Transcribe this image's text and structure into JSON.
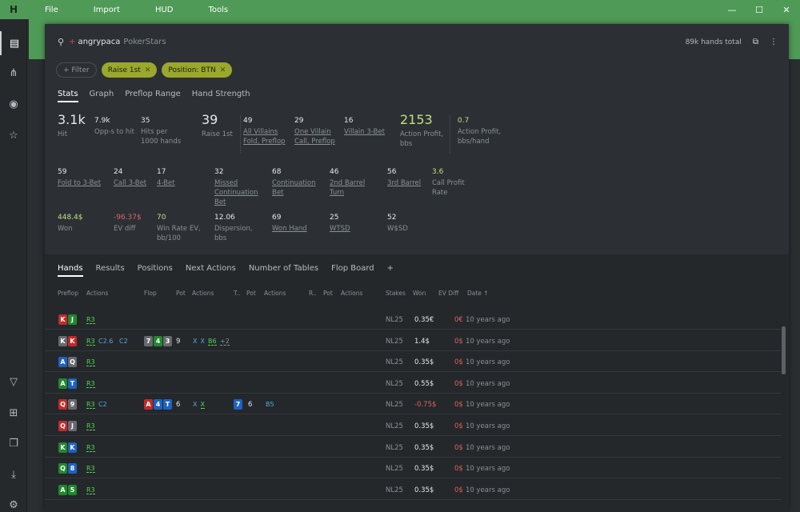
{
  "titlebar": {
    "logo": "H",
    "menu": [
      "File",
      "Import",
      "HUD",
      "Tools"
    ],
    "controls": [
      "—",
      "☐",
      "✕"
    ]
  },
  "sidebar": {
    "top_icons": [
      "report-icon",
      "share-icon",
      "broadcast-icon",
      "star-list-icon"
    ],
    "bottom_icons": [
      "filter-icon",
      "layout-icon",
      "windows-icon",
      "download-icon",
      "settings-icon"
    ]
  },
  "header": {
    "plus": "+",
    "username": "angrypaca",
    "site": "PokerStars",
    "total": "89k hands total"
  },
  "filters": {
    "add_label": "Filter",
    "chips": [
      "Raise 1st",
      "Position: BTN"
    ]
  },
  "stat_tabs": [
    "Stats",
    "Graph",
    "Preflop Range",
    "Hand Strength"
  ],
  "stats_row1": [
    {
      "value": "3.1k",
      "label": "Hit",
      "big": true
    },
    {
      "value": "7.9k",
      "label": "Opp-s to hit"
    },
    {
      "value": "35",
      "label": "Hits per 1000 hands"
    },
    {
      "value": "39",
      "label": "Raise 1st",
      "big": true
    },
    {
      "value": "49",
      "label": "All Villains Fold, Preflop",
      "link": true
    },
    {
      "value": "29",
      "label": "One Villain Call, Preflop",
      "link": true
    },
    {
      "value": "16",
      "label": "Villain 3-Bet",
      "link": true
    },
    {
      "value": "2153",
      "label": "Action Profit, bbs",
      "big": true,
      "color": "green"
    },
    {
      "value": "0.7",
      "label": "Action Profit, bbs/hand",
      "color": "green"
    }
  ],
  "stats_row2": [
    {
      "value": "59",
      "label": "Fold to 3-Bet",
      "link": true
    },
    {
      "value": "24",
      "label": "Call 3-Bet",
      "link": true
    },
    {
      "value": "17",
      "label": "4-Bet",
      "link": true
    },
    {
      "value": "32",
      "label": "Missed Continuation Bet",
      "link": true
    },
    {
      "value": "68",
      "label": "Continuation Bet",
      "link": true
    },
    {
      "value": "46",
      "label": "2nd Barrel Turn",
      "link": true
    },
    {
      "value": "56",
      "label": "3rd Barrel",
      "link": true
    },
    {
      "value": "3.6",
      "label": "Call Profit Rate",
      "color": "green"
    }
  ],
  "stats_row3": [
    {
      "value": "448.4$",
      "label": "Won",
      "color": "green"
    },
    {
      "value": "-96.37$",
      "label": "EV diff",
      "color": "red"
    },
    {
      "value": "70",
      "label": "Win Rate EV, bb/100",
      "color": "green"
    },
    {
      "value": "12.06",
      "label": "Dispersion, bbs"
    },
    {
      "value": "69",
      "label": "Won Hand",
      "link": true
    },
    {
      "value": "25",
      "label": "WTSD",
      "link": true
    },
    {
      "value": "52",
      "label": "W$SD"
    }
  ],
  "hand_tabs": [
    "Hands",
    "Results",
    "Positions",
    "Next Actions",
    "Number of Tables",
    "Flop Board",
    "+"
  ],
  "columns": [
    "Preflop",
    "Actions",
    "Flop",
    "Pot",
    "Actions",
    "T..",
    "Pot",
    "Actions",
    "R..",
    "Pot",
    "Actions",
    "Stakes",
    "Won",
    "EV Diff",
    "Date ↑"
  ],
  "rows": [
    {
      "pre": [
        [
          "K",
          "r"
        ],
        [
          "J",
          "g"
        ]
      ],
      "pre_act": [
        [
          "R3",
          "green"
        ]
      ],
      "stakes": "NL25",
      "won": "0.35€",
      "evd": "0€",
      "date": "10 years ago"
    },
    {
      "pre": [
        [
          "K",
          "k"
        ],
        [
          "K",
          "r"
        ]
      ],
      "pre_act": [
        [
          "R3",
          "green"
        ],
        [
          "C2.6",
          "blue"
        ],
        [
          "C2",
          "blue"
        ]
      ],
      "flop": [
        [
          "7",
          "k"
        ],
        [
          "4",
          "g"
        ],
        [
          "3",
          "k"
        ]
      ],
      "flop_pot": "9",
      "flop_act": [
        [
          "X",
          "blue"
        ],
        [
          "X",
          "blue"
        ],
        [
          "B6",
          "green"
        ],
        [
          "+2",
          "grey"
        ]
      ],
      "stakes": "NL25",
      "won": "1.4$",
      "evd": "0$",
      "date": "10 years ago"
    },
    {
      "pre": [
        [
          "A",
          "b"
        ],
        [
          "Q",
          "k"
        ]
      ],
      "pre_act": [
        [
          "R3",
          "green"
        ]
      ],
      "stakes": "NL25",
      "won": "0.35$",
      "evd": "0$",
      "date": "10 years ago"
    },
    {
      "pre": [
        [
          "A",
          "g"
        ],
        [
          "T",
          "b"
        ]
      ],
      "pre_act": [
        [
          "R3",
          "green"
        ]
      ],
      "stakes": "NL25",
      "won": "0.55$",
      "evd": "0$",
      "date": "10 years ago"
    },
    {
      "pre": [
        [
          "Q",
          "r"
        ],
        [
          "9",
          "k"
        ]
      ],
      "pre_act": [
        [
          "R3",
          "green"
        ],
        [
          "C2",
          "blue"
        ]
      ],
      "flop": [
        [
          "A",
          "r"
        ],
        [
          "4",
          "b"
        ],
        [
          "T",
          "b"
        ]
      ],
      "flop_pot": "6",
      "flop_act": [
        [
          "X",
          "blue"
        ],
        [
          "X",
          "green"
        ]
      ],
      "turn": [
        [
          "7",
          "b"
        ]
      ],
      "turn_pot": "6",
      "turn_act": [
        [
          "B5",
          "blue"
        ]
      ],
      "stakes": "NL25",
      "won": "-0.75$",
      "won_neg": true,
      "evd": "0$",
      "date": "10 years ago"
    },
    {
      "pre": [
        [
          "Q",
          "r"
        ],
        [
          "J",
          "k"
        ]
      ],
      "pre_act": [
        [
          "R3",
          "green"
        ]
      ],
      "stakes": "NL25",
      "won": "0.35$",
      "evd": "0$",
      "date": "10 years ago"
    },
    {
      "pre": [
        [
          "K",
          "g"
        ],
        [
          "K",
          "b"
        ]
      ],
      "pre_act": [
        [
          "R3",
          "green"
        ]
      ],
      "stakes": "NL25",
      "won": "0.35$",
      "evd": "0$",
      "date": "10 years ago"
    },
    {
      "pre": [
        [
          "Q",
          "g"
        ],
        [
          "8",
          "b"
        ]
      ],
      "pre_act": [
        [
          "R3",
          "green"
        ]
      ],
      "stakes": "NL25",
      "won": "0.35$",
      "evd": "0$",
      "date": "10 years ago"
    },
    {
      "pre": [
        [
          "A",
          "g"
        ],
        [
          "5",
          "g"
        ]
      ],
      "pre_act": [
        [
          "R3",
          "green"
        ]
      ],
      "stakes": "NL25",
      "won": "0.35$",
      "evd": "0$",
      "date": "10 years ago"
    }
  ]
}
